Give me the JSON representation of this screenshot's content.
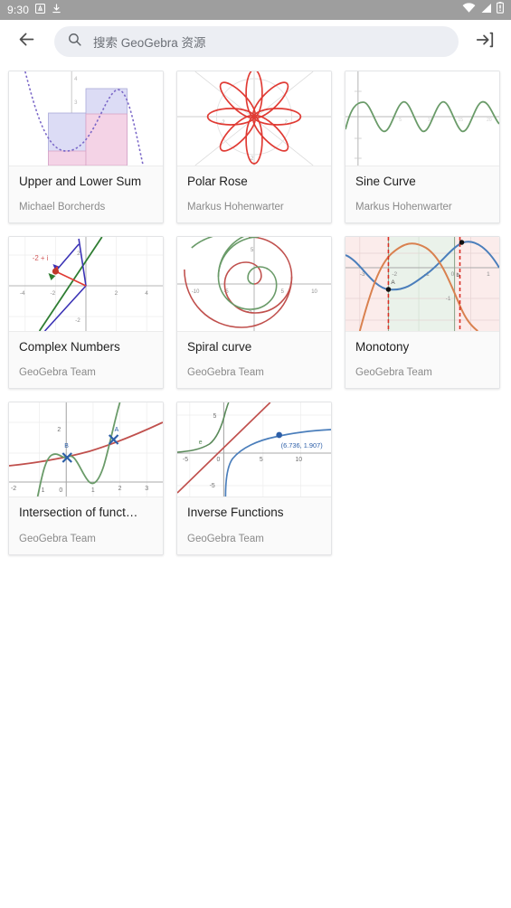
{
  "status_bar": {
    "time": "9:30",
    "left_icons": [
      "screenshot-icon",
      "download-icon"
    ],
    "right_icons": [
      "wifi-icon",
      "signal-icon",
      "battery-icon"
    ],
    "background_color": "#9e9e9e"
  },
  "toolbar": {
    "back_icon": "arrow-back-icon",
    "search_icon": "search-icon",
    "search_placeholder": "搜索 GeoGebra 资源",
    "search_value": "",
    "login_icon": "sign-in-icon"
  },
  "cards": [
    {
      "title": "Upper and Lower Sum",
      "author": "Michael Borcherds",
      "thumb": "upper-lower-sum-thumbnail",
      "accent": "#7b68c8"
    },
    {
      "title": "Polar Rose",
      "author": "Markus Hohenwarter",
      "thumb": "polar-rose-thumbnail",
      "accent": "#e03b34"
    },
    {
      "title": "Sine Curve",
      "author": "Markus Hohenwarter",
      "thumb": "sine-curve-thumbnail",
      "accent": "#6a9b69"
    },
    {
      "title": "Complex Numbers",
      "author": "GeoGebra Team",
      "thumb": "complex-numbers-thumbnail",
      "accent": "#3a32b5",
      "label": "-2 + i"
    },
    {
      "title": "Spiral curve",
      "author": "GeoGebra Team",
      "thumb": "spiral-curve-thumbnail",
      "accent": "#c0504d"
    },
    {
      "title": "Monotony",
      "author": "GeoGebra Team",
      "thumb": "monotony-thumbnail",
      "accent": "#4a7ebb"
    },
    {
      "title": "Intersection of funct…",
      "author": "GeoGebra Team",
      "thumb": "intersection-of-functions-thumbnail",
      "accent": "#c0504d"
    },
    {
      "title": "Inverse Functions",
      "author": "GeoGebra Team",
      "thumb": "inverse-functions-thumbnail",
      "accent": "#3b6fb6",
      "label": "(6.736, 1.907)"
    }
  ]
}
